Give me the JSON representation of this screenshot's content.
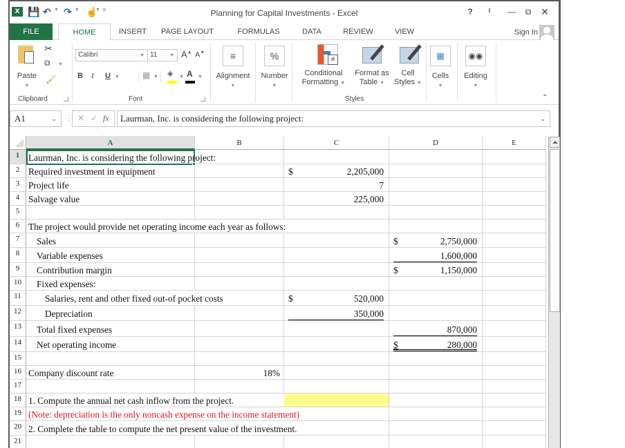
{
  "window": {
    "title": "Planning for Capital Investments - Excel",
    "help_label": "?",
    "buttons": [
      "help",
      "ribbon-display-options",
      "minimize",
      "restore",
      "close"
    ]
  },
  "quick_access": {
    "icons": [
      "excel-logo",
      "save-icon",
      "undo-icon",
      "redo-icon",
      "touch-mode-icon",
      "customize-qat-icon"
    ]
  },
  "tabs": [
    {
      "label": "FILE",
      "active": false
    },
    {
      "label": "HOME",
      "active": true
    },
    {
      "label": "INSERT",
      "active": false
    },
    {
      "label": "PAGE LAYOUT",
      "active": false
    },
    {
      "label": "FORMULAS",
      "active": false
    },
    {
      "label": "DATA",
      "active": false
    },
    {
      "label": "REVIEW",
      "active": false
    },
    {
      "label": "VIEW",
      "active": false
    }
  ],
  "account": {
    "sign_in_label": "Sign In"
  },
  "ribbon": {
    "clipboard": {
      "paste_label": "Paste",
      "group_label": "Clipboard"
    },
    "font": {
      "font_name": "Calibri",
      "font_size": "11",
      "bold": "B",
      "italic": "I",
      "underline": "U",
      "group_label": "Font",
      "fill_color": "#ffff00",
      "font_color": "#000000"
    },
    "alignment": {
      "label": "Alignment"
    },
    "number": {
      "label": "Number",
      "icon_text": "%"
    },
    "styles": {
      "conditional_formatting": [
        "Conditional",
        "Formatting"
      ],
      "format_as_table": [
        "Format as",
        "Table"
      ],
      "cell_styles": [
        "Cell",
        "Styles"
      ],
      "group_label": "Styles"
    },
    "cells": {
      "label": "Cells"
    },
    "editing": {
      "label": "Editing"
    }
  },
  "formula_bar": {
    "name_box": "A1",
    "fx_label": "fx",
    "formula": "Laurman, Inc. is considering the following project:"
  },
  "sheet": {
    "columns": [
      "A",
      "B",
      "C",
      "D",
      "E"
    ],
    "selected_cell": "A1",
    "highlight_color": "#fdfd8c",
    "rows": [
      {
        "n": "1",
        "a": "Laurman, Inc. is considering the following project:"
      },
      {
        "n": "2",
        "a": "Required investment in equipment",
        "c_sym": "$",
        "c": "2,205,000"
      },
      {
        "n": "3",
        "a": "Project life",
        "c": "7"
      },
      {
        "n": "4",
        "a": "Salvage value",
        "c": "225,000"
      },
      {
        "n": "5"
      },
      {
        "n": "6",
        "a": "The project would provide net operating income each year as follows:"
      },
      {
        "n": "7",
        "a": "Sales",
        "d_sym": "$",
        "d": "2,750,000"
      },
      {
        "n": "8",
        "a": "Variable expenses",
        "d": "1,600,000"
      },
      {
        "n": "9",
        "a": "Contribution margin",
        "d_sym": "$",
        "d": "1,150,000"
      },
      {
        "n": "10",
        "a": "Fixed expenses:"
      },
      {
        "n": "11",
        "a": "Salaries, rent and other fixed out-of pocket costs",
        "c_sym": "$",
        "c": "520,000"
      },
      {
        "n": "12",
        "a": "Depreciation",
        "c": "350,000"
      },
      {
        "n": "13",
        "a": "Total fixed expenses",
        "d": "870,000"
      },
      {
        "n": "14",
        "a": "Net operating income",
        "d_sym": "$",
        "d": "280,000"
      },
      {
        "n": "15"
      },
      {
        "n": "16",
        "a": "Company discount rate",
        "b": "18%"
      },
      {
        "n": "17"
      },
      {
        "n": "18",
        "a": "1. Compute the annual net cash inflow from the project."
      },
      {
        "n": "19",
        "a": "(Note: depreciation is the only noncash expense on the income statement)"
      },
      {
        "n": "20",
        "a": "2. Complete the table to compute the net present value of the investment."
      },
      {
        "n": "21"
      }
    ]
  }
}
